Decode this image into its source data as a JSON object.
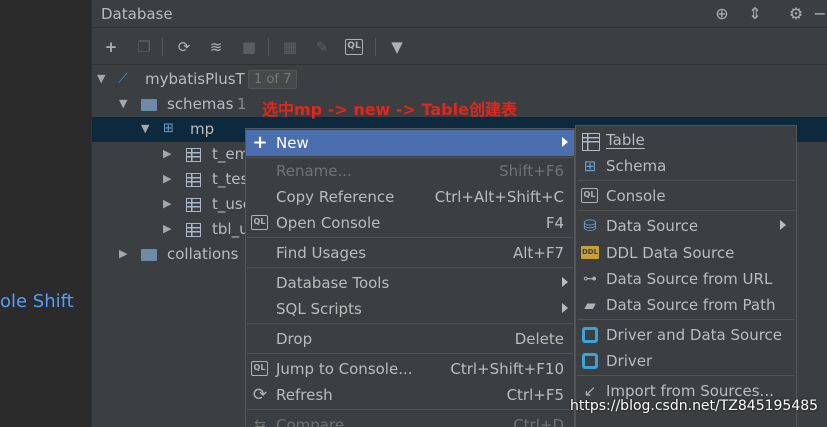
{
  "editor_fragment": "ole Shift",
  "tool_window": {
    "title": "Database",
    "header_icons": [
      "target-icon",
      "collapse-all-icon",
      "gear-icon",
      "hide-icon"
    ],
    "toolbar_icons": [
      "add-icon",
      "copy-icon",
      "refresh-icon",
      "schema-sync-icon",
      "stop-icon",
      "table-view-icon",
      "edit-icon",
      "ql-console-icon",
      "filter-icon"
    ]
  },
  "tree": {
    "root": {
      "label": "mybatisPlusT",
      "badge": "1 of 7"
    },
    "schemas": {
      "label": "schemas",
      "count": "1"
    },
    "mp": {
      "label": "mp"
    },
    "tables": [
      "t_em",
      "t_tes",
      "t_use",
      "tbl_u"
    ],
    "collations": {
      "label": "collations"
    }
  },
  "annotation": "选中mp -> new -> Table创建表",
  "context_menu": {
    "items": [
      {
        "label": "New",
        "shortcut": "",
        "icon": "plus-icon"
      },
      {
        "label": "Rename...",
        "shortcut": "Shift+F6"
      },
      {
        "label": "Copy Reference",
        "shortcut": "Ctrl+Alt+Shift+C"
      },
      {
        "label": "Open Console",
        "shortcut": "F4",
        "icon": "QL"
      },
      {
        "label": "Find Usages",
        "shortcut": "Alt+F7"
      },
      {
        "label": "Database Tools",
        "shortcut": ""
      },
      {
        "label": "SQL Scripts",
        "shortcut": ""
      },
      {
        "label": "Drop",
        "shortcut": "Delete"
      },
      {
        "label": "Jump to Console...",
        "shortcut": "Ctrl+Shift+F10",
        "icon": "QL"
      },
      {
        "label": "Refresh",
        "shortcut": "Ctrl+F5"
      },
      {
        "label": "Compare",
        "shortcut": "Ctrl+D"
      }
    ]
  },
  "sub_menu": {
    "items": [
      {
        "label": "Table"
      },
      {
        "label": "Schema"
      },
      {
        "label": "Console",
        "icon": "QL"
      },
      {
        "label": "Data Source"
      },
      {
        "label": "DDL Data Source",
        "icon": "DDL"
      },
      {
        "label": "Data Source from URL"
      },
      {
        "label": "Data Source from Path"
      },
      {
        "label": "Driver and Data Source"
      },
      {
        "label": "Driver"
      },
      {
        "label": "Import from Sources..."
      }
    ]
  },
  "watermark": "https://blog.csdn.net/TZ845195485",
  "colors": {
    "accent": "#4b6eaf",
    "selection": "#0d293e",
    "annotation": "#e3251b",
    "background": "#3c3f41"
  }
}
